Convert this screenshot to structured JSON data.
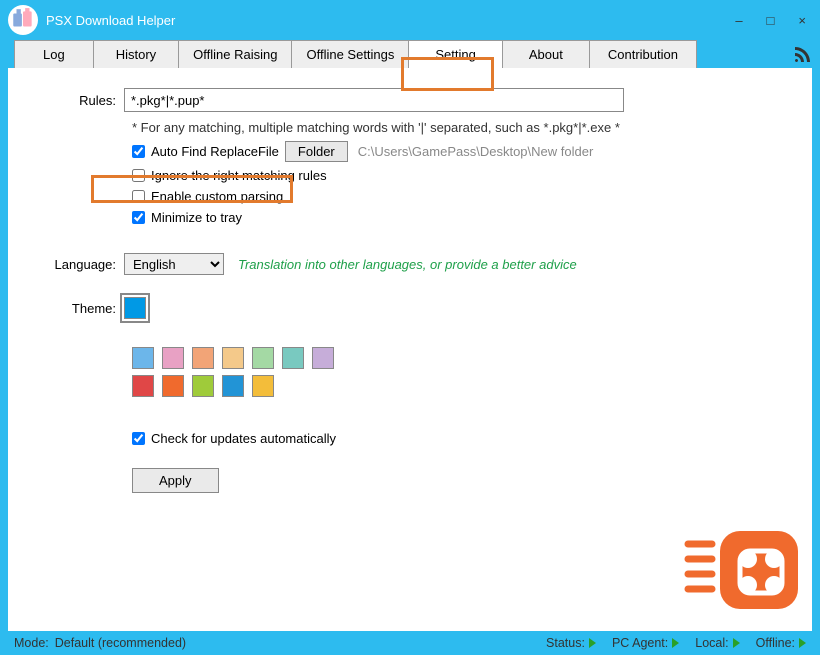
{
  "title": "PSX Download Helper",
  "tabs": [
    {
      "label": "Log"
    },
    {
      "label": "History"
    },
    {
      "label": "Offline Raising"
    },
    {
      "label": "Offline Settings"
    },
    {
      "label": "Setting",
      "active": true
    },
    {
      "label": "About"
    },
    {
      "label": "Contribution"
    }
  ],
  "rules": {
    "label": "Rules:",
    "value": "*.pkg*|*.pup*",
    "hint": "* For any matching, multiple matching words with '|' separated, such as *.pkg*|*.exe *"
  },
  "options": {
    "autofind": {
      "label": "Auto Find ReplaceFile",
      "checked": true
    },
    "folder_btn": "Folder",
    "folder_path": "C:\\Users\\GamePass\\Desktop\\New folder",
    "ignore": {
      "label": "Ignore the right matching rules",
      "checked": false
    },
    "custom": {
      "label": "Enable custom parsing",
      "checked": false
    },
    "minimize": {
      "label": "Minimize to tray",
      "checked": true
    }
  },
  "language": {
    "label": "Language:",
    "value": "English",
    "hint": "Translation into other languages, or provide a better advice"
  },
  "theme": {
    "label": "Theme:",
    "current": "#0099e5",
    "swatches": [
      [
        "#6cb6ea",
        "#e8a1c4",
        "#f2a477",
        "#f4c98a",
        "#a4d9a4",
        "#79c9c0",
        "#c6add9"
      ],
      [
        "#e04747",
        "#f06a2d",
        "#9fcb3a",
        "#2294d6",
        "#f3bd3a"
      ]
    ]
  },
  "updates": {
    "label": "Check for updates automatically",
    "checked": true
  },
  "apply": "Apply",
  "statusbar": {
    "mode_label": "Mode:",
    "mode_value": "Default (recommended)",
    "status": "Status:",
    "pcagent": "PC Agent:",
    "local": "Local:",
    "offline": "Offline:"
  }
}
